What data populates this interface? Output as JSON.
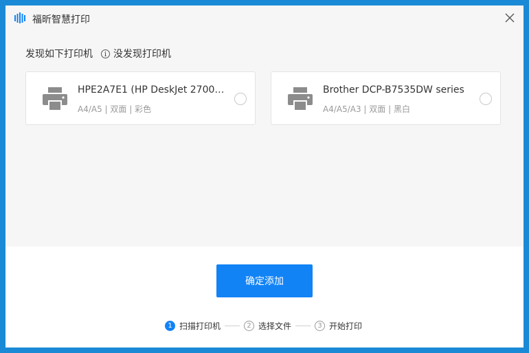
{
  "window": {
    "title": "福昕智慧打印",
    "accent_color": "#1283f5"
  },
  "main": {
    "section_title": "发现如下打印机",
    "info_icon_glyph": "i",
    "not_found_link": "没发现打印机",
    "printers": [
      {
        "name": "HPE2A7E1 (HP DeskJet 2700 s...",
        "spec": "A4/A5 | 双面 | 彩色",
        "icon": "printer-icon",
        "selected": false
      },
      {
        "name": "Brother DCP-B7535DW series",
        "spec": "A4/A5/A3 | 双面 | 黑白",
        "icon": "printer-icon",
        "selected": false
      }
    ]
  },
  "footer": {
    "confirm_label": "确定添加",
    "steps": [
      {
        "num": "1",
        "label": "扫描打印机",
        "active": true
      },
      {
        "num": "2",
        "label": "选择文件",
        "active": false
      },
      {
        "num": "3",
        "label": "开始打印",
        "active": false
      }
    ]
  }
}
